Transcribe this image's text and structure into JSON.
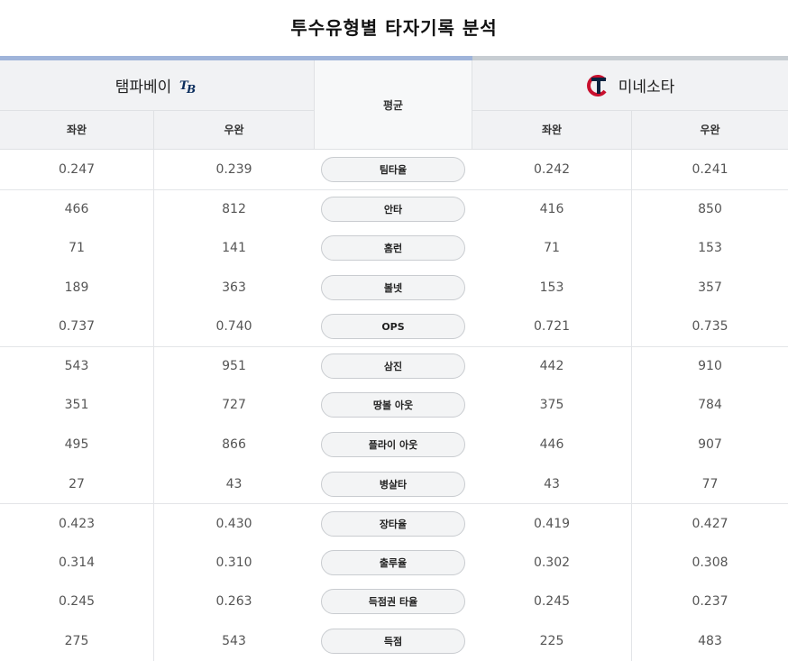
{
  "title": "투수유형별 타자기록 분석",
  "teams": {
    "left": {
      "name": "탬파베이",
      "logo": "rays-tb-logo"
    },
    "right": {
      "name": "미네소타",
      "logo": "twins-tc-logo"
    }
  },
  "header": {
    "average_label": "평균",
    "left_sub": [
      "좌완",
      "우완"
    ],
    "right_sub": [
      "좌완",
      "우완"
    ]
  },
  "rows": [
    {
      "label": "팀타율",
      "l_left": "0.247",
      "l_right": "0.239",
      "r_left": "0.242",
      "r_right": "0.241"
    },
    {
      "label": "안타",
      "l_left": "466",
      "l_right": "812",
      "r_left": "416",
      "r_right": "850"
    },
    {
      "label": "홈런",
      "l_left": "71",
      "l_right": "141",
      "r_left": "71",
      "r_right": "153"
    },
    {
      "label": "볼넷",
      "l_left": "189",
      "l_right": "363",
      "r_left": "153",
      "r_right": "357"
    },
    {
      "label": "OPS",
      "l_left": "0.737",
      "l_right": "0.740",
      "r_left": "0.721",
      "r_right": "0.735"
    },
    {
      "label": "삼진",
      "l_left": "543",
      "l_right": "951",
      "r_left": "442",
      "r_right": "910"
    },
    {
      "label": "땅볼 아웃",
      "l_left": "351",
      "l_right": "727",
      "r_left": "375",
      "r_right": "784"
    },
    {
      "label": "플라이 아웃",
      "l_left": "495",
      "l_right": "866",
      "r_left": "446",
      "r_right": "907"
    },
    {
      "label": "병살타",
      "l_left": "27",
      "l_right": "43",
      "r_left": "43",
      "r_right": "77"
    },
    {
      "label": "장타율",
      "l_left": "0.423",
      "l_right": "0.430",
      "r_left": "0.419",
      "r_right": "0.427"
    },
    {
      "label": "출루율",
      "l_left": "0.314",
      "l_right": "0.310",
      "r_left": "0.302",
      "r_right": "0.308"
    },
    {
      "label": "득점권 타율",
      "l_left": "0.245",
      "l_right": "0.263",
      "r_left": "0.245",
      "r_right": "0.237"
    },
    {
      "label": "득점",
      "l_left": "275",
      "l_right": "543",
      "r_left": "225",
      "r_right": "483"
    }
  ],
  "colors": {
    "left_accent": "#9fb4da",
    "right_accent": "#c7cdd2",
    "twins_red": "#c8102e",
    "twins_navy": "#0c2340",
    "rays_navy": "#092c5c"
  }
}
